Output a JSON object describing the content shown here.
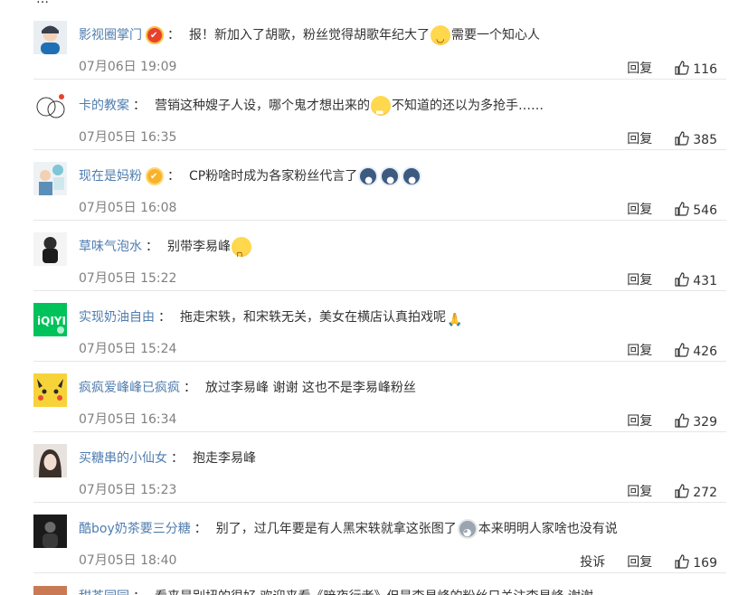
{
  "top_partial": {
    "text": "…",
    "count": ""
  },
  "comments": [
    {
      "username": "影视圈掌门",
      "badge": "red",
      "content": "报！新加入了胡歌，粉丝觉得胡歌年纪大了",
      "emoji1": "laugh-cry",
      "content2": "需要一个知心人",
      "time": "07月06日 19:09",
      "reply_label": "回复",
      "likes": "116"
    },
    {
      "username": "卡的教案",
      "badge": "",
      "content": "营销这种嫂子人设，哪个鬼才想出来的",
      "emoji1": "grin",
      "content2": "不知道的还以为多抢手……",
      "time": "07月05日 16:35",
      "reply_label": "回复",
      "likes": "385"
    },
    {
      "username": "现在是妈粉",
      "badge": "gold",
      "content": "CP粉啥时成为各家粉丝代言了",
      "emoji1": "penguin",
      "content2": "",
      "time": "07月05日 16:08",
      "reply_label": "回复",
      "likes": "546"
    },
    {
      "username": "草味气泡水",
      "badge": "",
      "content": "别带李易峰",
      "emoji1": "sad",
      "content2": "",
      "time": "07月05日 15:22",
      "reply_label": "回复",
      "likes": "431"
    },
    {
      "username": "实现奶油自由",
      "badge": "",
      "content": "拖走宋轶，和宋轶无关，美女在横店认真拍戏呢",
      "emoji1": "pray",
      "content2": "",
      "time": "07月05日 15:24",
      "reply_label": "回复",
      "likes": "426"
    },
    {
      "username": "疯疯爱峰峰已疯疯",
      "badge": "",
      "content": "放过李易峰 谢谢 这也不是李易峰粉丝",
      "emoji1": "",
      "content2": "",
      "time": "07月05日 16:34",
      "reply_label": "回复",
      "likes": "329"
    },
    {
      "username": "买糖串的小仙女",
      "badge": "",
      "content": "抱走李易峰",
      "emoji1": "",
      "content2": "",
      "time": "07月05日 15:23",
      "reply_label": "回复",
      "likes": "272"
    },
    {
      "username": "酷boy奶茶要三分糖",
      "badge": "",
      "content": "别了，过几年要是有人黑宋轶就拿这张图了",
      "emoji1": "husky",
      "content2": "本来明明人家啥也没有说",
      "time": "07月05日 18:40",
      "report_label": "投诉",
      "reply_label": "回复",
      "likes": "169"
    }
  ],
  "bottom_partial": {
    "username": "甜茶园园",
    "content": "看来是别扭的很好 欢迎来看《暗夜行者》但是李易峰的粉丝只关注李易峰 谢谢"
  },
  "colors": {
    "link": "#507daf",
    "divider": "#e6e6e6",
    "meta": "#808080"
  }
}
